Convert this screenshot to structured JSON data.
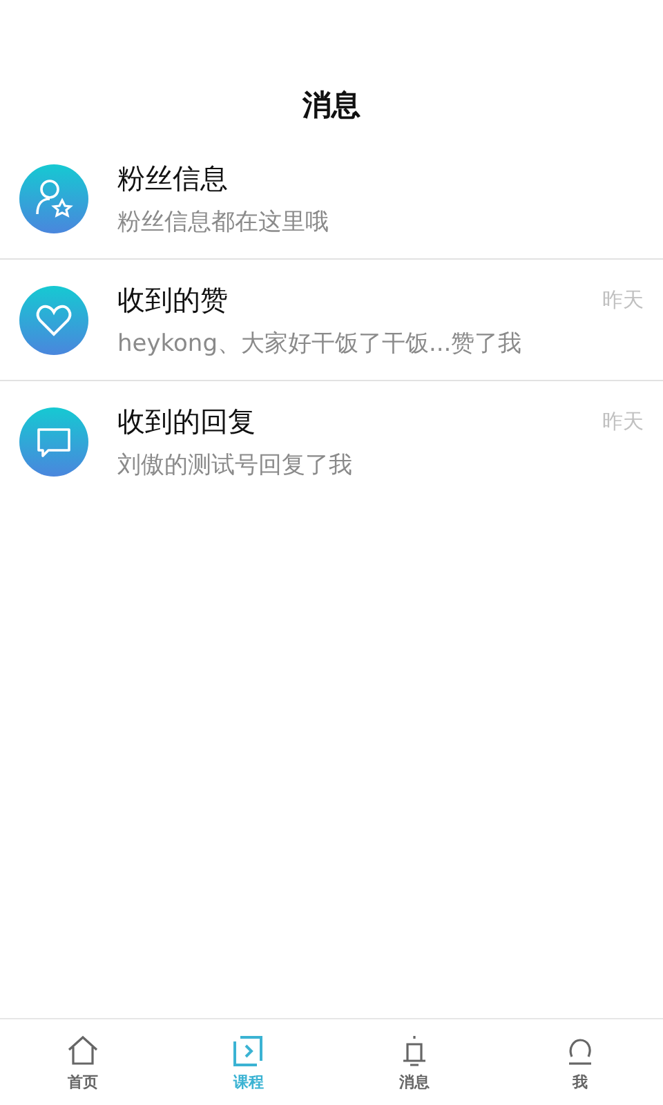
{
  "header": {
    "title": "消息"
  },
  "messages": [
    {
      "kind": "fans",
      "title": "粉丝信息",
      "preview": "粉丝信息都在这里哦"
    },
    {
      "kind": "like",
      "title": "收到的赞",
      "preview": "heykong、大家好干饭了干饭...赞了我",
      "time": "昨天"
    },
    {
      "kind": "reply",
      "title": "收到的回复",
      "preview": "刘傲的测试号回复了我",
      "time": "昨天"
    }
  ],
  "tab_bar": [
    {
      "kind": "home",
      "label": "首页",
      "selected": false
    },
    {
      "kind": "course",
      "label": "课程",
      "selected": true
    },
    {
      "kind": "bell",
      "label": "消息",
      "selected": false
    },
    {
      "kind": "user",
      "label": "我",
      "selected": false
    }
  ]
}
